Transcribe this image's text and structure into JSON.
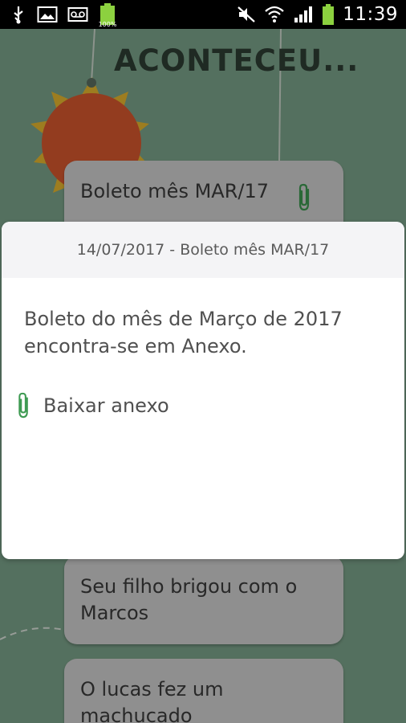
{
  "status_bar": {
    "time": "11:39",
    "battery_percent": "100%",
    "icons": [
      "usb-icon",
      "image-icon",
      "voicemail-icon",
      "battery-charging-icon",
      "mute-icon",
      "wifi-icon",
      "signal-icon",
      "battery-icon"
    ]
  },
  "app": {
    "title": "ACONTECEU...",
    "cards": [
      {
        "text": "Boleto mês MAR/17",
        "has_attachment": true
      },
      {
        "text": "Seu filho brigou com o Marcos",
        "has_attachment": false
      },
      {
        "text": "O lucas fez um machucado",
        "has_attachment": false
      }
    ]
  },
  "dialog": {
    "header": "14/07/2017 - Boleto mês MAR/17",
    "message": "Boleto do mês de Março de 2017 encontra-se em Anexo.",
    "attachment_label": "Baixar anexo"
  },
  "colors": {
    "background": "#7da58c",
    "accent_green": "#3e9a52",
    "sun": "#d9592f",
    "sun_rays": "#e8b830"
  }
}
